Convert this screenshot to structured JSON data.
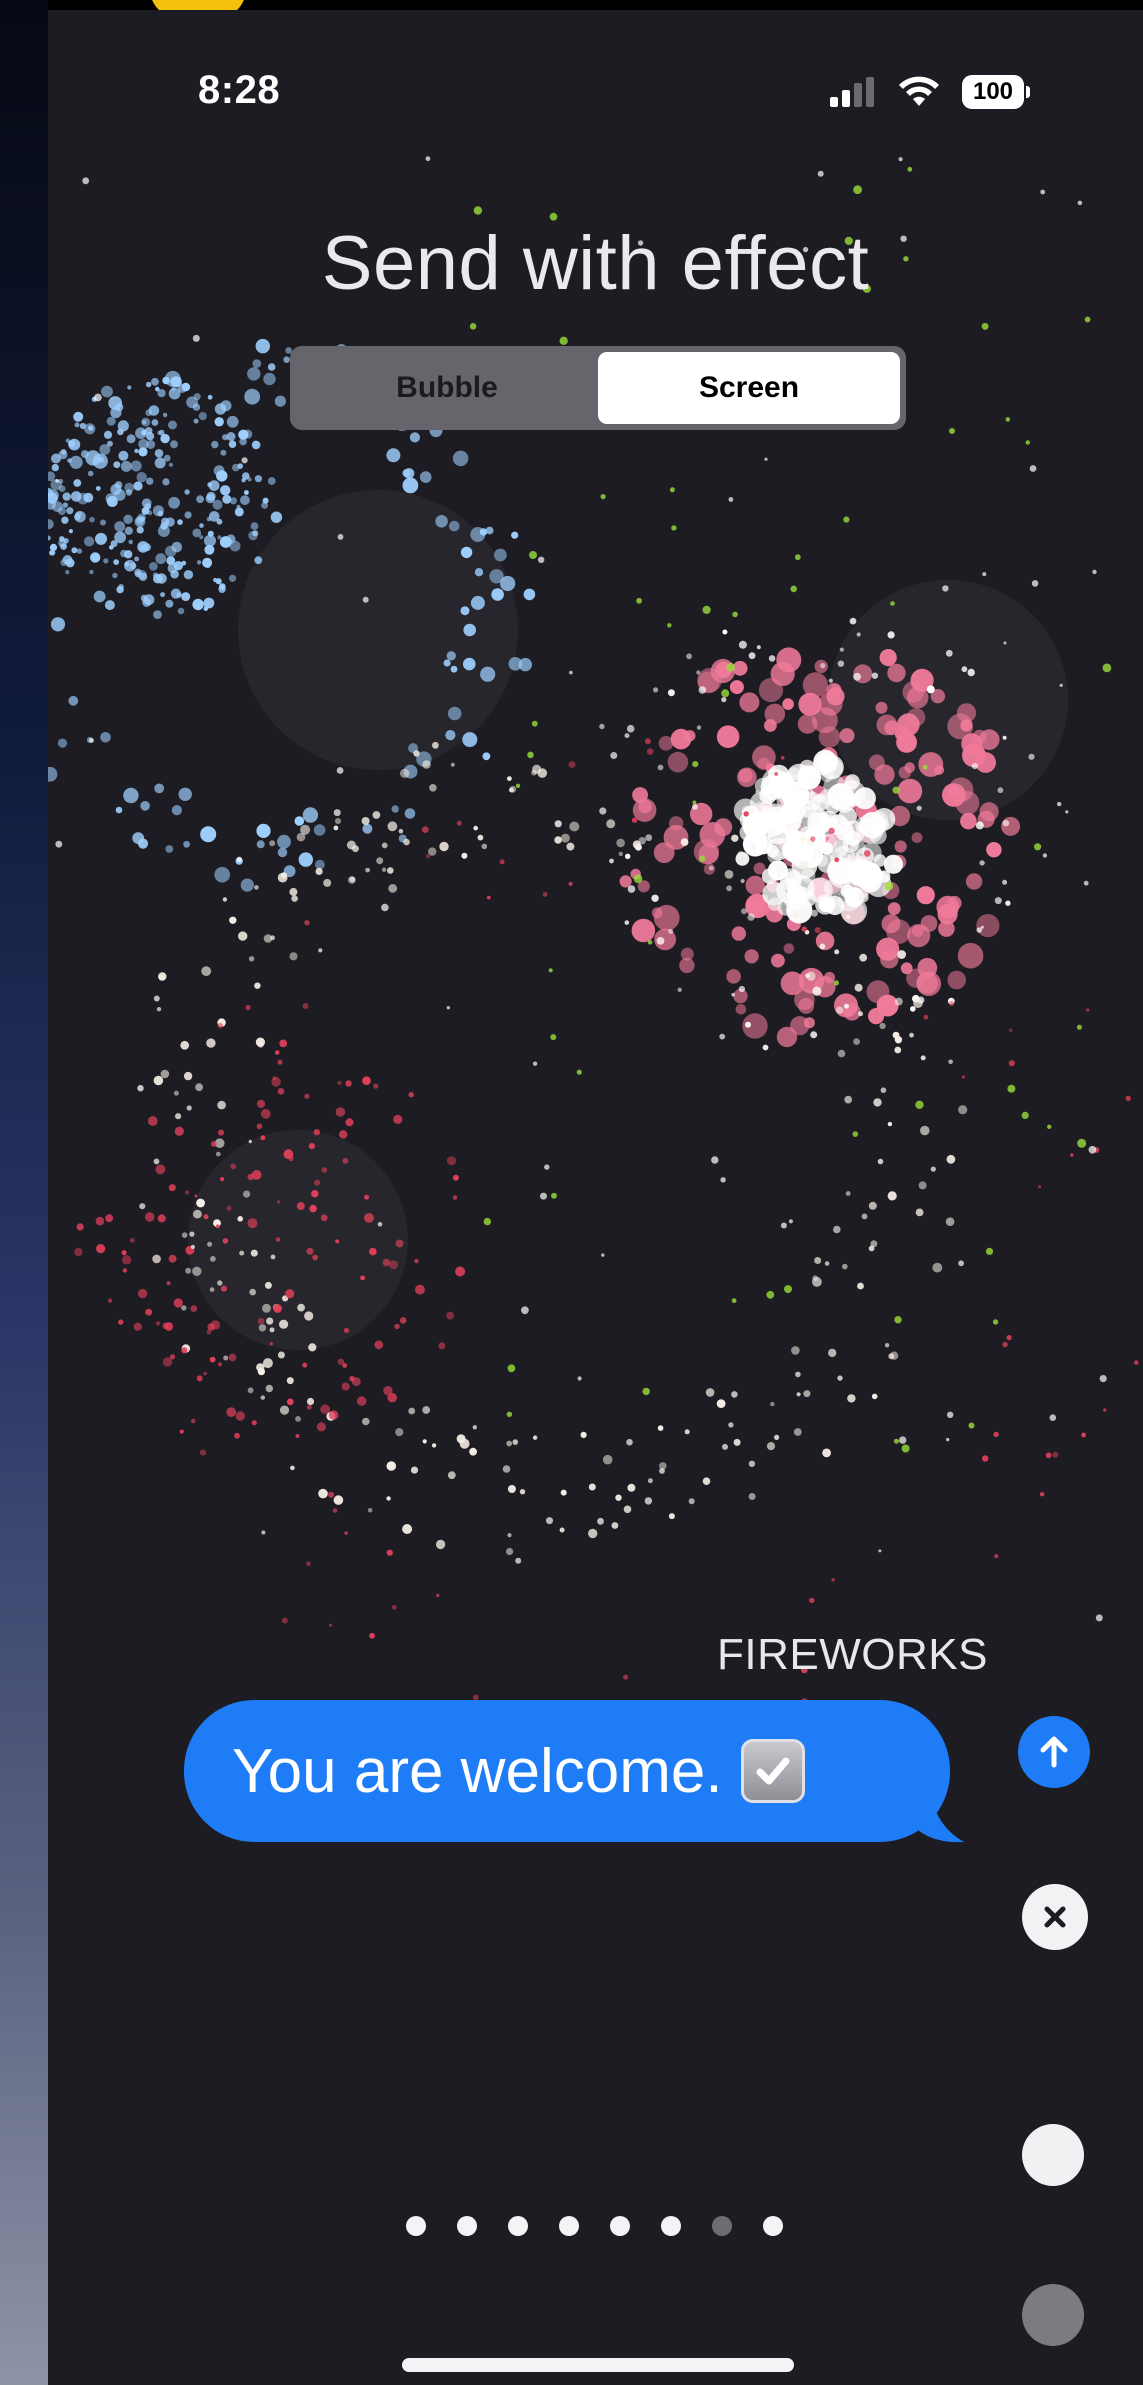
{
  "status_bar": {
    "time": "8:28",
    "battery": "100",
    "icons": [
      "signal-icon",
      "wifi-icon",
      "battery-icon"
    ]
  },
  "header": {
    "title": "Send with effect",
    "segments": [
      {
        "label": "Bubble",
        "selected": false
      },
      {
        "label": "Screen",
        "selected": true
      }
    ]
  },
  "effect": {
    "name": "FIREWORKS"
  },
  "message": {
    "text": "You are welcome.",
    "emoji_icon": "checkbox-emoji-icon"
  },
  "controls": {
    "send_icon": "arrow-up-icon",
    "cancel_icon": "close-icon"
  },
  "page_indicator": {
    "total": 8,
    "current_index": 6
  },
  "colors": {
    "background": "#1d1c22",
    "bubble": "#1f7cf7",
    "segment_track": "#66656c",
    "firework_pink": "#f07a9a",
    "firework_blue": "#9fd0ff",
    "firework_red": "#e0405a",
    "firework_green": "#9adf3a"
  }
}
